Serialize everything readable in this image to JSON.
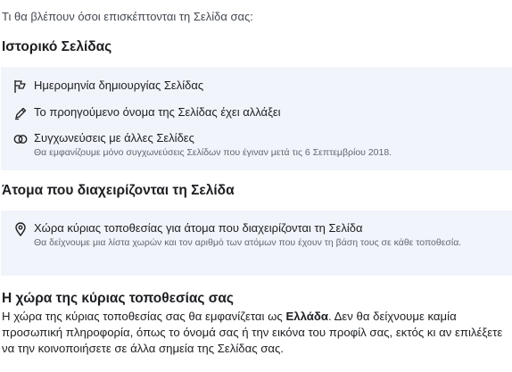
{
  "intro_text": "Τι θα βλέπουν όσοι επισκέπτονται τη Σελίδα σας:",
  "page_history": {
    "title": "Ιστορικό Σελίδας",
    "items": [
      {
        "icon": "flag-icon",
        "label": "Ημερομηνία δημιουργίας Σελίδας"
      },
      {
        "icon": "pencil-icon",
        "label": "Το προηγούμενο όνομα της Σελίδας έχει αλλάξει"
      },
      {
        "icon": "merge-circles-icon",
        "label": "Συγχωνεύσεις με άλλες Σελίδες",
        "sub": "Θα εμφανίζουμε μόνο συγχωνεύσεις Σελίδων που έγιναν μετά τις 6 Σεπτεμβρίου 2018."
      }
    ]
  },
  "page_managers": {
    "title": "Άτομα που διαχειρίζονται τη Σελίδα",
    "items": [
      {
        "icon": "location-pin-icon",
        "label": "Χώρα κύριας τοποθεσίας για άτομα που διαχειρίζονται τη Σελίδα",
        "sub": "Θα δείχνουμε μια λίστα χωρών και τον αριθμό των ατόμων που έχουν τη βάση τους σε κάθε τοποθεσία."
      }
    ]
  },
  "primary_country": {
    "title": "Η χώρα της κύριας τοποθεσίας σας",
    "text_before": "Η χώρα της κύριας τοποθεσίας σας θα εμφανίζεται ως ",
    "country": "Ελλάδα",
    "text_after": ". Δεν θα δείχνουμε καμία προσωπική πληροφορία, όπως το όνομά σας ή την εικόνα του προφίλ σας, εκτός κι αν επιλέξετε να την κοινοποιήσετε σε άλλα σημεία της Σελίδας σας."
  }
}
